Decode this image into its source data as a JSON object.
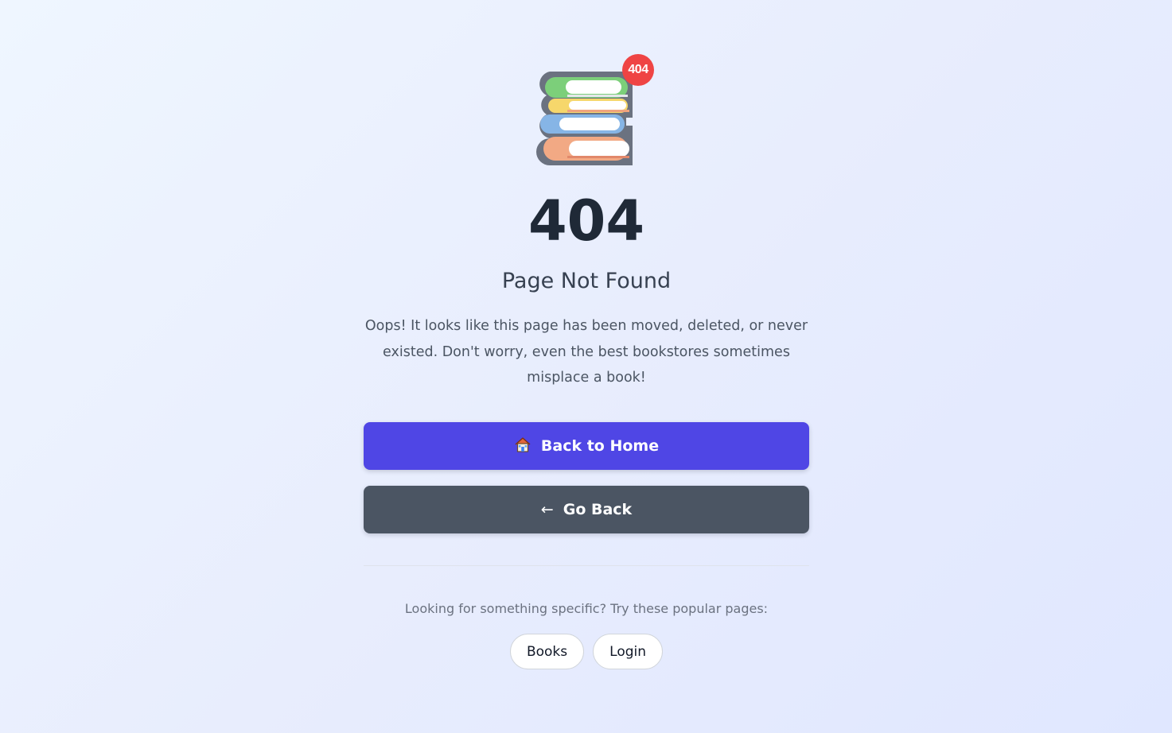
{
  "illustration": {
    "icon": "books-stack-icon",
    "badge_text": "404"
  },
  "error": {
    "code": "404",
    "title": "Page Not Found",
    "description": "Oops! It looks like this page has been moved, deleted, or never existed. Don't worry, even the best bookstores sometimes misplace a book!"
  },
  "actions": {
    "home_icon": "house-icon",
    "home_label": "Back to Home",
    "back_icon": "arrow-left-icon",
    "back_arrow": "←",
    "back_label": "Go Back"
  },
  "popular": {
    "label": "Looking for something specific? Try these popular pages:",
    "links": [
      "Books",
      "Login"
    ]
  },
  "colors": {
    "primary": "#4f46e5",
    "secondary": "#4b5563",
    "badge": "#ef4444",
    "heading": "#1f2937"
  }
}
